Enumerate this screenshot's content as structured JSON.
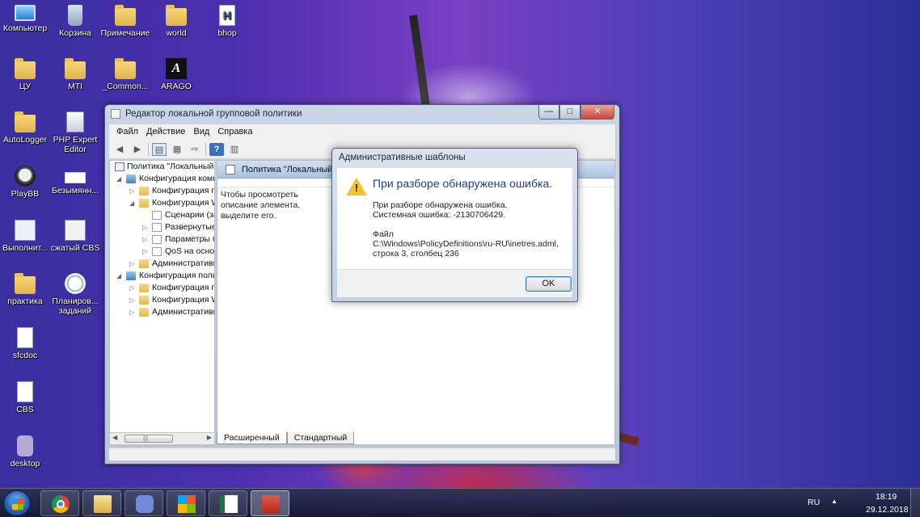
{
  "desktop": {
    "icons": [
      {
        "label": "Компьютер",
        "icon": "computer-icon"
      },
      {
        "label": "Корзина",
        "icon": "recycle-bin-icon"
      },
      {
        "label": "Примечание",
        "icon": "folder-icon"
      },
      {
        "label": "world",
        "icon": "folder-icon"
      },
      {
        "label": "bhop",
        "icon": "document-icon"
      },
      {
        "label": "ЦУ",
        "icon": "folder-icon"
      },
      {
        "label": "MTI",
        "icon": "folder-icon"
      },
      {
        "label": "_Common...",
        "icon": "folder-icon"
      },
      {
        "label": "ARAGO",
        "icon": "arago-icon"
      },
      {
        "label": "AutoLogger",
        "icon": "folder-icon"
      },
      {
        "label": "PHP Expert Editor",
        "icon": "php-editor-icon"
      },
      {
        "label": "PlayBB",
        "icon": "skull-icon"
      },
      {
        "label": "Безымянн...",
        "icon": "image-icon"
      },
      {
        "label": "Выполнит...",
        "icon": "search-doc-icon"
      },
      {
        "label": "сжатый CBS",
        "icon": "archive-icon"
      },
      {
        "label": "практика",
        "icon": "folder-icon"
      },
      {
        "label": "Планиров... заданий",
        "icon": "task-scheduler-icon"
      },
      {
        "label": "sfcdoc",
        "icon": "document-icon"
      },
      {
        "label": "CBS",
        "icon": "document-icon"
      },
      {
        "label": "desktop",
        "icon": "desktop-file-icon"
      }
    ]
  },
  "window": {
    "title": "Редактор локальной групповой политики",
    "caption_buttons": {
      "minimize": "—",
      "maximize": "□",
      "close": "✕"
    },
    "menu": [
      "Файл",
      "Действие",
      "Вид",
      "Справка"
    ],
    "toolbar": {
      "back": "◀",
      "forward": "▶",
      "help": "?"
    },
    "tree": [
      {
        "label": "Политика \"Локальный",
        "level": 0,
        "expander": "",
        "icon": "policy"
      },
      {
        "label": "Конфигурация компьютера",
        "level": 1,
        "expander": "◢",
        "icon": "comp"
      },
      {
        "label": "Конфигурация п",
        "level": 2,
        "expander": "▷",
        "icon": "folder"
      },
      {
        "label": "Конфигурация Windows",
        "level": 2,
        "expander": "◢",
        "icon": "folder"
      },
      {
        "label": "Сценарии (за",
        "level": 3,
        "expander": "",
        "icon": "doc"
      },
      {
        "label": "Развернутые",
        "level": 3,
        "expander": "▷",
        "icon": "doc"
      },
      {
        "label": "Параметры б",
        "level": 3,
        "expander": "▷",
        "icon": "doc"
      },
      {
        "label": "QoS на основ",
        "level": 3,
        "expander": "▷",
        "icon": "doc"
      },
      {
        "label": "Административные",
        "level": 2,
        "expander": "▷",
        "icon": "folder"
      },
      {
        "label": "Конфигурация пользователя",
        "level": 1,
        "expander": "◢",
        "icon": "comp"
      },
      {
        "label": "Конфигурация п",
        "level": 2,
        "expander": "▷",
        "icon": "folder"
      },
      {
        "label": "Конфигурация Windows",
        "level": 2,
        "expander": "▷",
        "icon": "folder"
      },
      {
        "label": "Административные",
        "level": 2,
        "expander": "▷",
        "icon": "folder"
      }
    ],
    "scroll": {
      "left": "◀",
      "right": "▶",
      "grip": "|||"
    },
    "content": {
      "header": "Политика \"Локальный компьютер\"",
      "description": "Чтобы просмотреть описание элемента, выделите его."
    },
    "tabs": [
      "Расширенный",
      "Стандартный"
    ]
  },
  "dialog": {
    "title": "Административные шаблоны",
    "main_instruction": "При разборе обнаружена ошибка.",
    "lines": [
      "При разборе обнаружена ошибка.",
      "Системная ошибка: -2130706429.",
      "",
      "Файл",
      "C:\\Windows\\PolicyDefinitions\\ru-RU\\inetres.adml,",
      "строка 3, столбец 236"
    ],
    "ok_label": "OK",
    "warning_mark": "!"
  },
  "taskbar": {
    "apps": [
      {
        "name": "chrome",
        "state": "pinned"
      },
      {
        "name": "explorer",
        "state": "pinned"
      },
      {
        "name": "discord",
        "state": "pinned"
      },
      {
        "name": "windows",
        "state": "pinned"
      },
      {
        "name": "sheet",
        "state": "pinned"
      },
      {
        "name": "toolbox",
        "state": "active"
      }
    ],
    "language": "RU",
    "tray_arrow": "▲",
    "time": "18:19",
    "date": "29.12.2018"
  },
  "colors": {
    "wallpaper": "#4b2fae",
    "dialog_instruction": "#1c3f94",
    "warning": "#f2c230"
  }
}
